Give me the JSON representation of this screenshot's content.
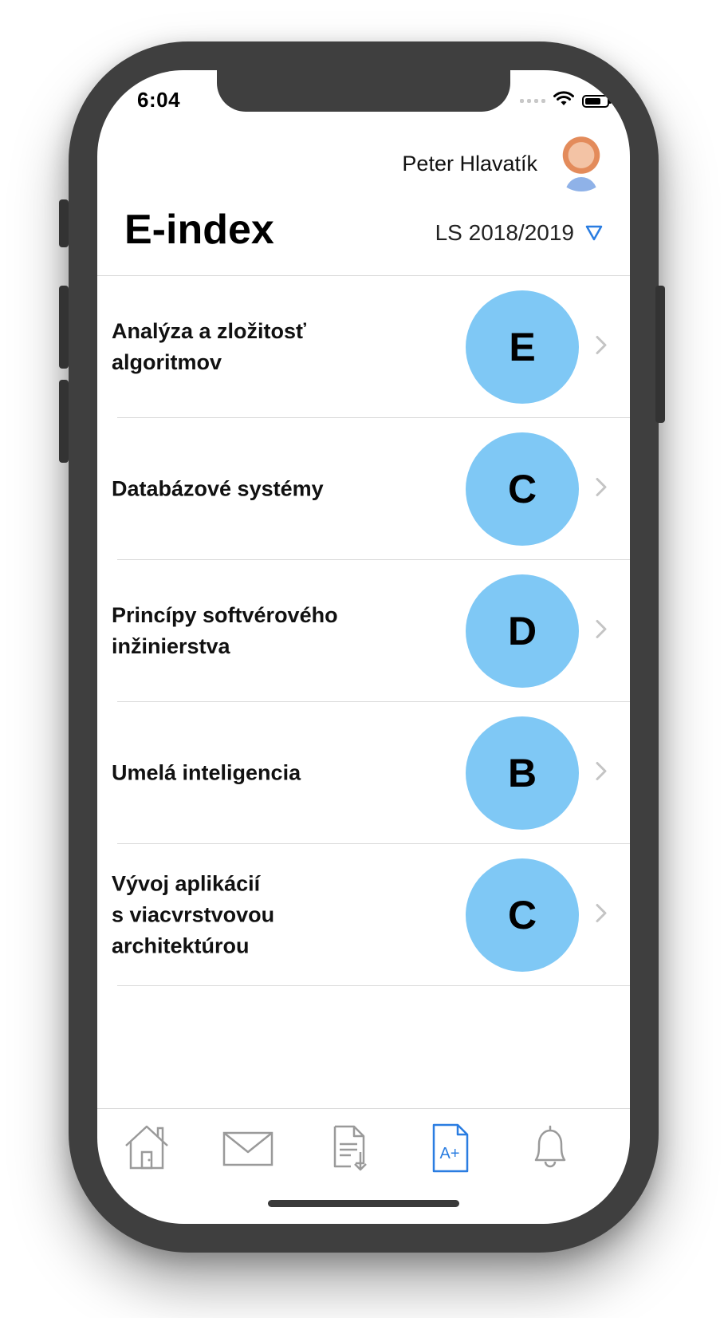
{
  "status_bar": {
    "time": "6:04"
  },
  "header": {
    "user_name": "Peter Hlavatík",
    "title": "E-index",
    "semester": "LS 2018/2019"
  },
  "courses": [
    {
      "title": "Analýza a zložitosť\nalgoritmov",
      "grade": "E"
    },
    {
      "title": "Databázové systémy",
      "grade": "C"
    },
    {
      "title": "Princípy softvérového\ninžinierstva",
      "grade": "D"
    },
    {
      "title": "Umelá inteligencia",
      "grade": "B"
    },
    {
      "title": "Vývoj aplikácií\ns viacvrstvovou\narchitektúrou",
      "grade": "C"
    }
  ],
  "tab_bar": {
    "tabs": [
      {
        "icon": "home-icon",
        "active": false
      },
      {
        "icon": "mail-icon",
        "active": false
      },
      {
        "icon": "document-download-icon",
        "active": false
      },
      {
        "icon": "grades-icon",
        "label": "A+",
        "active": true
      },
      {
        "icon": "bell-icon",
        "active": false
      }
    ]
  },
  "colors": {
    "grade_circle": "#7fc8f5",
    "accent": "#2a7de1",
    "inactive_icon": "#9a9a9a",
    "separator": "#d9d9d9"
  }
}
